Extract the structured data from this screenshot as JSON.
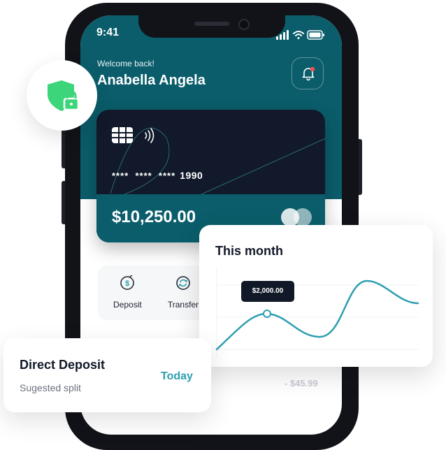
{
  "status_bar": {
    "time": "9:41"
  },
  "header": {
    "greeting": "Welcome back!",
    "user_name": "Anabella Angela"
  },
  "card": {
    "masked_groups": "****  ****  ****",
    "last4": "1990",
    "balance": "$10,250.00"
  },
  "actions": [
    {
      "label": "Deposit",
      "icon": "deposit-icon"
    },
    {
      "label": "Transfer",
      "icon": "transfer-icon"
    }
  ],
  "transactions": {
    "faded_amount": "- $45.99"
  },
  "this_month": {
    "title": "This month",
    "tooltip": "$2,000.00"
  },
  "direct_deposit": {
    "title": "Direct Deposit",
    "subtitle": "Sugested split",
    "date": "Today"
  },
  "colors": {
    "teal": "#0b5d6b",
    "card_dark": "#11192a",
    "chart_line": "#2e9fb0",
    "shield_green": "#3dd57a",
    "notification_dot": "#f05252"
  }
}
